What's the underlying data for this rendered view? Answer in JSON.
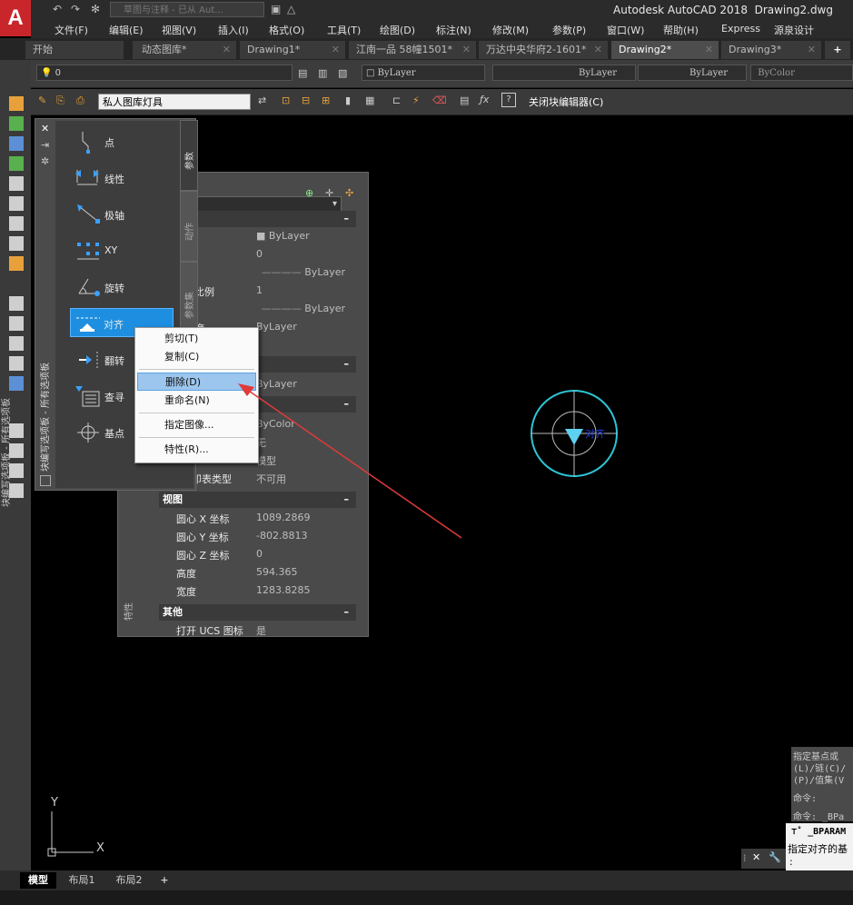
{
  "title_bar": {
    "app_name": "Autodesk AutoCAD 2018",
    "file_name": "Drawing2.dwg",
    "workspace": "草图与注释 - 已从 Aut..."
  },
  "menu_bar": [
    "文件(F)",
    "编辑(E)",
    "视图(V)",
    "插入(I)",
    "格式(O)",
    "工具(T)",
    "绘图(D)",
    "标注(N)",
    "修改(M)",
    "参数(P)",
    "窗口(W)",
    "帮助(H)",
    "Express",
    "源泉设计"
  ],
  "tabs": [
    {
      "label": "开始",
      "active": false
    },
    {
      "label": "动态图库*",
      "active": false
    },
    {
      "label": "Drawing1*",
      "active": false
    },
    {
      "label": "江南一品 58幢1501*",
      "active": false
    },
    {
      "label": "万达中央华府2-1601*",
      "active": false
    },
    {
      "label": "Drawing2*",
      "active": true
    },
    {
      "label": "Drawing3*",
      "active": false
    }
  ],
  "layer_toolbar": {
    "layer": "0",
    "color": "ByLayer",
    "linetype": "ByLayer",
    "lineweight": "ByLayer",
    "plotstyle": "ByColor"
  },
  "block_editor": {
    "block_name": "私人图库灯具",
    "close_label": "关闭块编辑器(C)"
  },
  "left_strip_title": "块编写选项板 - 所有选项板",
  "palette": {
    "title": "块编写选项板 - 所有选项板",
    "items": [
      "点",
      "线性",
      "极轴",
      "XY",
      "旋转",
      "对齐",
      "翻转",
      "查寻",
      "基点"
    ],
    "selected": "对齐",
    "tabs": [
      "参数",
      "动作",
      "参数集"
    ]
  },
  "properties": {
    "title": "特性",
    "rows_top": [
      {
        "label": "",
        "value": "ByLayer"
      },
      {
        "label": "",
        "value": "0"
      },
      {
        "label": "",
        "value": "ByLayer"
      },
      {
        "label": "比例",
        "value": "1"
      },
      {
        "label": "",
        "value": "ByLayer"
      },
      {
        "label": "度",
        "value": "ByLayer"
      }
    ],
    "row_mid": {
      "value": "ByLayer"
    },
    "rows_mid2": [
      {
        "label": "",
        "value": "ByColor"
      },
      {
        "label": "",
        "value": "无"
      },
      {
        "label": "",
        "value": "模型"
      },
      {
        "label": "打印表类型",
        "value": "不可用"
      }
    ],
    "view_section": "视图",
    "view_rows": [
      {
        "label": "圆心 X 坐标",
        "value": "1089.2869"
      },
      {
        "label": "圆心 Y 坐标",
        "value": "-802.8813"
      },
      {
        "label": "圆心 Z 坐标",
        "value": "0"
      },
      {
        "label": "高度",
        "value": "594.365"
      },
      {
        "label": "宽度",
        "value": "1283.8285"
      }
    ],
    "other_section": "其他",
    "other_rows": [
      {
        "label": "打开 UCS 图标",
        "value": "是"
      }
    ]
  },
  "context_menu": [
    {
      "label": "剪切(T)",
      "highlight": false
    },
    {
      "label": "复制(C)",
      "highlight": false
    },
    {
      "label": "删除(D)",
      "highlight": true
    },
    {
      "label": "重命名(N)",
      "highlight": false
    },
    {
      "label": "指定图像...",
      "highlight": false
    },
    {
      "label": "特性(R)...",
      "highlight": false
    }
  ],
  "canvas": {
    "align_label": "对齐",
    "ucs_x": "X",
    "ucs_y": "Y"
  },
  "command": {
    "history": [
      "指定基点或",
      "(L)/链(C)/",
      "(P)/值集(V",
      "命令:",
      "命令: _BPa"
    ],
    "current": "_BPARAM",
    "prompt": "指定对齐的基",
    "prompt2": ":"
  },
  "layout_tabs": [
    {
      "label": "模型",
      "active": true
    },
    {
      "label": "布局1",
      "active": false
    },
    {
      "label": "布局2",
      "active": false
    }
  ],
  "colors": {
    "accent": "#1e8fe0",
    "circle": "#2ec4d4",
    "arrow": "#e03a3a",
    "triangle": "#5fd0f0"
  }
}
